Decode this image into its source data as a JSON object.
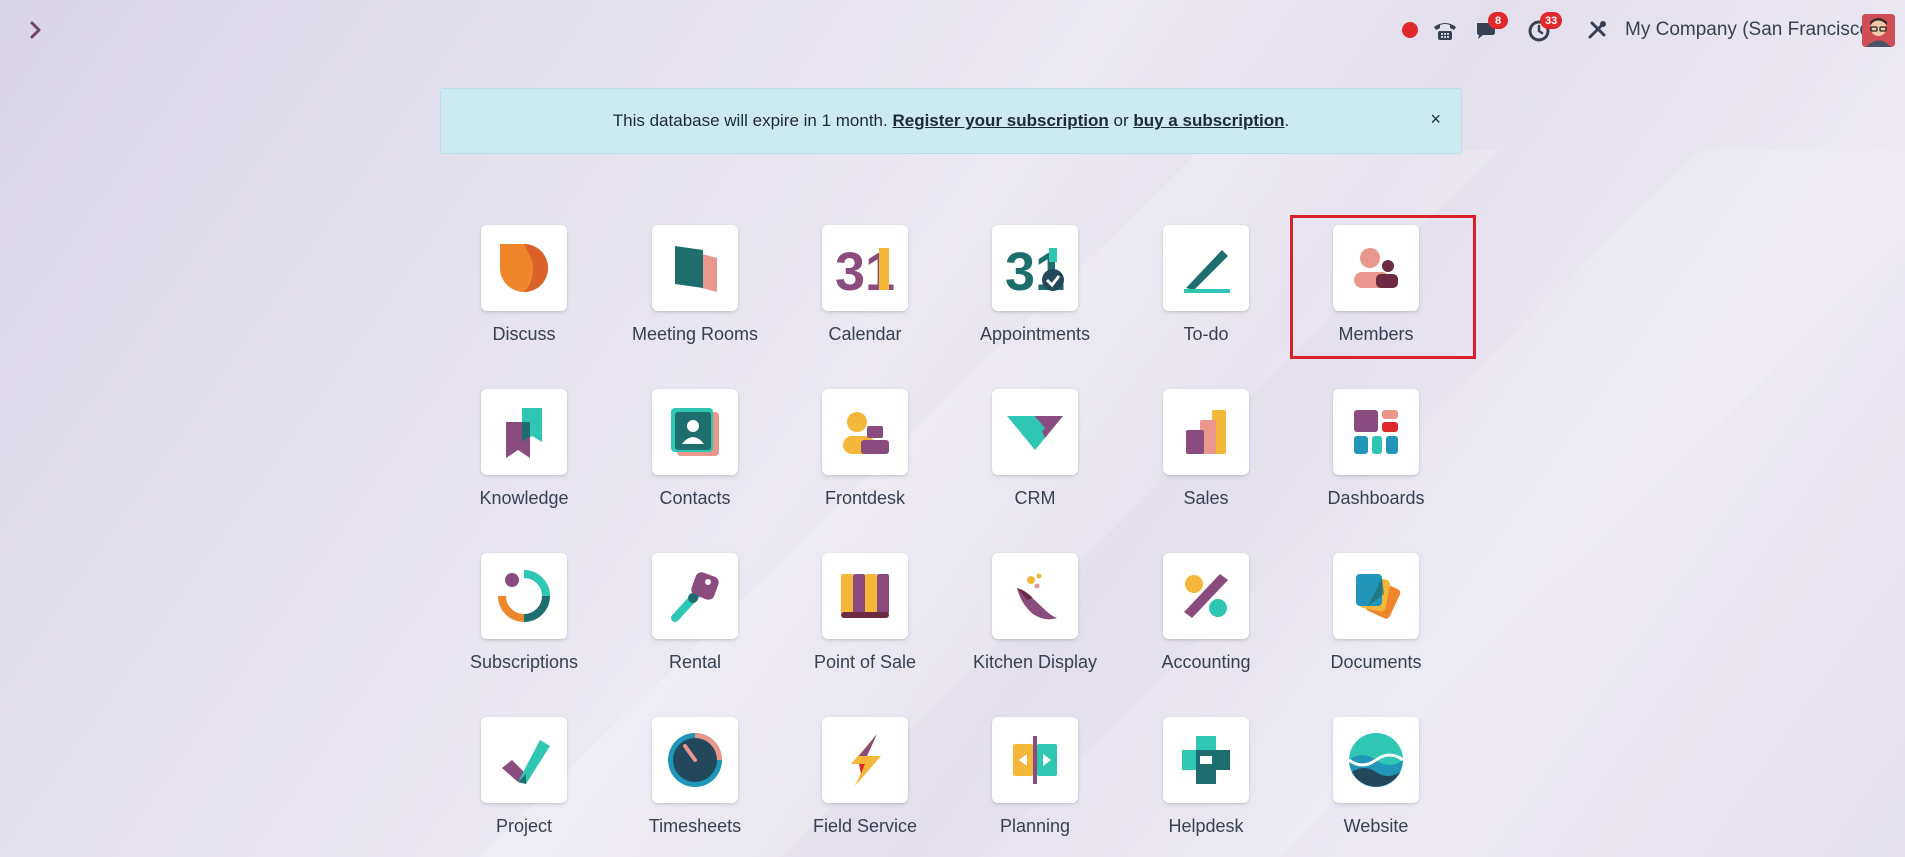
{
  "systray": {
    "chat_count": "8",
    "activity_count": "33",
    "company": "My Company (San Francisco)"
  },
  "banner": {
    "text_before": "This database will expire in 1 month. ",
    "register_link": "Register your subscription",
    "text_middle": " or ",
    "buy_link": "buy a subscription",
    "text_after": ".",
    "close": "×"
  },
  "apps": [
    {
      "label": "Discuss"
    },
    {
      "label": "Meeting Rooms"
    },
    {
      "label": "Calendar"
    },
    {
      "label": "Appointments"
    },
    {
      "label": "To-do"
    },
    {
      "label": "Members"
    },
    {
      "label": "Knowledge"
    },
    {
      "label": "Contacts"
    },
    {
      "label": "Frontdesk"
    },
    {
      "label": "CRM"
    },
    {
      "label": "Sales"
    },
    {
      "label": "Dashboards"
    },
    {
      "label": "Subscriptions"
    },
    {
      "label": "Rental"
    },
    {
      "label": "Point of Sale"
    },
    {
      "label": "Kitchen Display"
    },
    {
      "label": "Accounting"
    },
    {
      "label": "Documents"
    },
    {
      "label": "Project"
    },
    {
      "label": "Timesheets"
    },
    {
      "label": "Field Service"
    },
    {
      "label": "Planning"
    },
    {
      "label": "Helpdesk"
    },
    {
      "label": "Website"
    }
  ],
  "icons": {
    "calendar_glyph": "31",
    "appointments_glyph": "31"
  },
  "colors": {
    "accent": "#71456b",
    "badge": "#e0292c",
    "highlight": "#d9202b",
    "banner_bg": "#cdeaf0"
  }
}
